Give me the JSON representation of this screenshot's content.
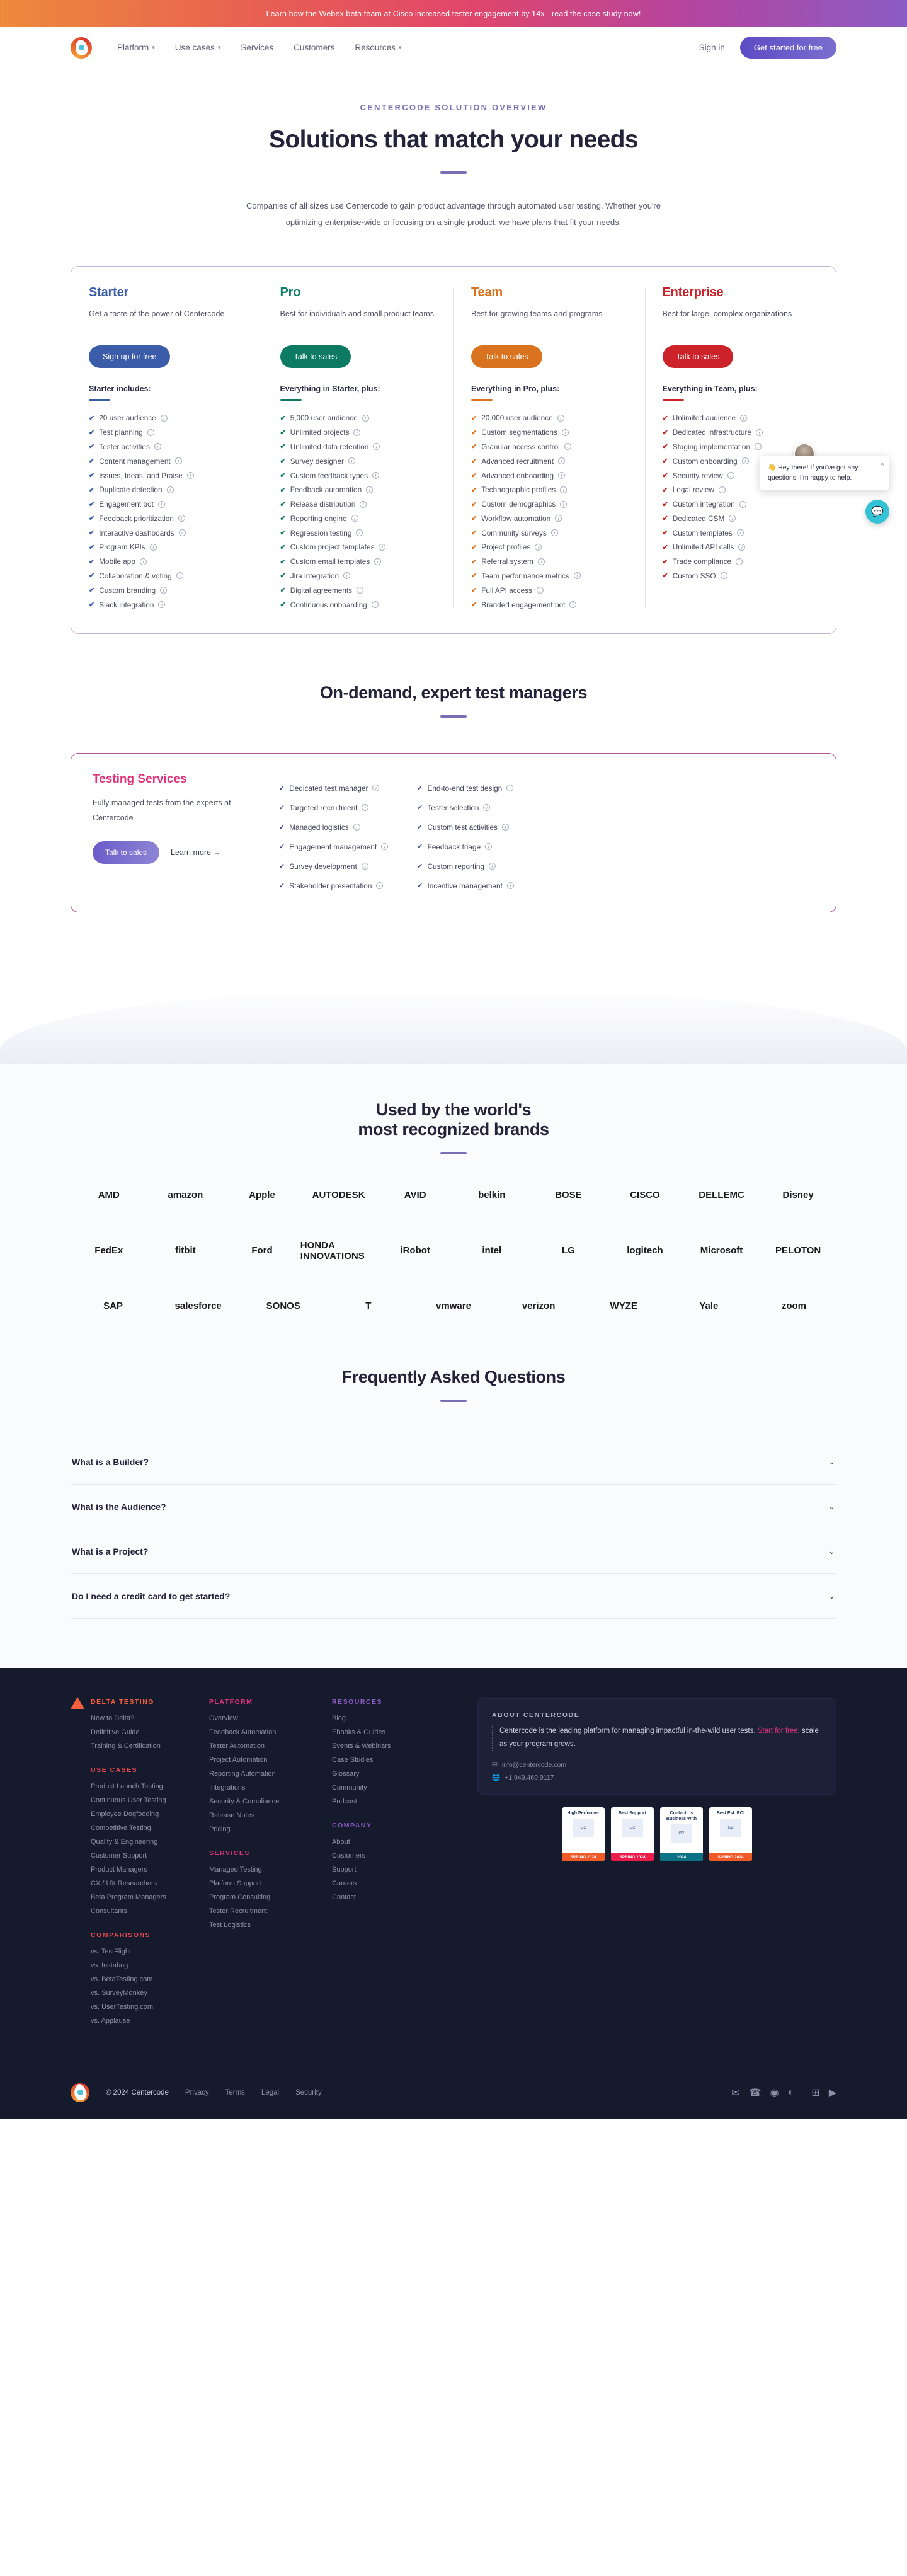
{
  "banner": {
    "text": "Learn how the Webex beta team at Cisco increased tester engagement by 14x - read the case study now!"
  },
  "nav": {
    "links": [
      {
        "label": "Platform",
        "has_caret": true
      },
      {
        "label": "Use cases",
        "has_caret": true
      },
      {
        "label": "Services",
        "has_caret": false
      },
      {
        "label": "Customers",
        "has_caret": false
      },
      {
        "label": "Resources",
        "has_caret": true
      }
    ],
    "signin": "Sign in",
    "cta": "Get started for free"
  },
  "hero": {
    "eyebrow": "CENTERCODE SOLUTION OVERVIEW",
    "title": "Solutions that match your needs",
    "body": "Companies of all sizes use Centercode to gain product advantage through automated user testing. Whether you're optimizing enterprise-wide or focusing on a single product, we have plans that fit your needs."
  },
  "plans": [
    {
      "name": "Starter",
      "color": "#3b5ca8",
      "desc": "Get a taste of the power of Centercode",
      "cta": "Sign up for free",
      "includes": "Starter includes:",
      "features": [
        "20 user audience",
        "Test planning",
        "Tester activities",
        "Content management",
        "Issues, Ideas, and Praise",
        "Duplicate detection",
        "Engagement bot",
        "Feedback prioritization",
        "Interactive dashboards",
        "Program KPIs",
        "Mobile app",
        "Collaboration & voting",
        "Custom branding",
        "Slack integration"
      ]
    },
    {
      "name": "Pro",
      "color": "#0d7a63",
      "desc": "Best for individuals and small product teams",
      "cta": "Talk to sales",
      "includes": "Everything in Starter, plus:",
      "features": [
        "5,000 user audience",
        "Unlimited projects",
        "Unlimited data retention",
        "Survey designer",
        "Custom feedback types",
        "Feedback automation",
        "Release distribution",
        "Reporting engine",
        "Regression testing",
        "Custom project templates",
        "Custom email templates",
        "Jira integration",
        "Digital agreements",
        "Continuous onboarding"
      ]
    },
    {
      "name": "Team",
      "color": "#d9731f",
      "desc": "Best for growing teams and programs",
      "cta": "Talk to sales",
      "includes": "Everything in Pro, plus:",
      "features": [
        "20,000 user audience",
        "Custom segmentations",
        "Granular access control",
        "Advanced recruitment",
        "Advanced onboarding",
        "Technographic profiles",
        "Custom demographics",
        "Workflow automation",
        "Community surveys",
        "Project profiles",
        "Referral system",
        "Team performance metrics",
        "Full API access",
        "Branded engagement bot"
      ]
    },
    {
      "name": "Enterprise",
      "color": "#cc2229",
      "desc": "Best for large, complex organizations",
      "cta": "Talk to sales",
      "includes": "Everything in Team, plus:",
      "features": [
        "Unlimited audience",
        "Dedicated infrastructure",
        "Staging implementation",
        "Custom onboarding",
        "Security review",
        "Legal review",
        "Custom integration",
        "Dedicated CSM",
        "Custom templates",
        "Unlimited API calls",
        "Trade compliance",
        "Custom SSO"
      ]
    }
  ],
  "chat": {
    "message": "👋 Hey there! If you've got any questions, I'm happy to help.",
    "close": "×"
  },
  "services": {
    "heading": "On-demand, expert test managers",
    "card_title": "Testing Services",
    "card_desc": "Fully managed tests from the experts at Centercode",
    "cta": "Talk to sales",
    "learn_more": "Learn more →",
    "col1": [
      "Dedicated test manager",
      "Targeted recruitment",
      "Managed logistics",
      "Engagement management",
      "Survey development",
      "Stakeholder presentation"
    ],
    "col2": [
      "End-to-end test design",
      "Tester selection",
      "Custom test activities",
      "Feedback triage",
      "Custom reporting",
      "Incentive management"
    ]
  },
  "brands": {
    "heading_line1": "Used by the world's",
    "heading_line2": "most recognized brands",
    "rows": [
      [
        "AMD",
        "amazon",
        "Apple",
        "AUTODESK",
        "AVID",
        "belkin",
        "BOSE",
        "CISCO",
        "DELLEMC",
        "Disney"
      ],
      [
        "FedEx",
        "fitbit",
        "Ford",
        "HONDA INNOVATIONS",
        "iRobot",
        "intel",
        "LG",
        "logitech",
        "Microsoft",
        "PELOTON"
      ],
      [
        "SAP",
        "salesforce",
        "SONOS",
        "T",
        "vmware",
        "verizon",
        "WYZE",
        "Yale",
        "zoom"
      ]
    ]
  },
  "faq": {
    "heading": "Frequently Asked Questions",
    "items": [
      {
        "q": "What is a Builder?",
        "chevron": "⌄"
      },
      {
        "q": "What is the Audience?",
        "chevron": "⌄"
      },
      {
        "q": "What is a Project?",
        "chevron": "⌄"
      },
      {
        "q": "Do I need a credit card to get started?",
        "chevron": "⌄"
      }
    ]
  },
  "footer": {
    "col1": [
      {
        "head": "DELTA TESTING",
        "head_color": "orange",
        "links": [
          "New to Delta?",
          "Definitive Guide",
          "Training & Certification"
        ]
      },
      {
        "head": "USE CASES",
        "head_color": "red",
        "links": [
          "Product Launch Testing",
          "Continuous User Testing",
          "Employee Dogfooding",
          "Competitive Testing",
          "Quality & Engineering",
          "Customer Support",
          "Product Managers",
          "CX / UX Researchers",
          "Beta Program Managers",
          "Consultants"
        ]
      },
      {
        "head": "COMPARISONS",
        "head_color": "red",
        "links": [
          "vs. TestFlight",
          "vs. Instabug",
          "vs. BetaTesting.com",
          "vs. SurveyMonkey",
          "vs. UserTesting.com",
          "vs. Applause"
        ]
      }
    ],
    "col2": [
      {
        "head": "PLATFORM",
        "head_color": "pink",
        "links": [
          "Overview",
          "Feedback Automation",
          "Tester Automation",
          "Project Automation",
          "Reporting Automation",
          "Integrations",
          "Security & Compliance",
          "Release Notes",
          "Pricing"
        ]
      },
      {
        "head": "SERVICES",
        "head_color": "pink",
        "links": [
          "Managed Testing",
          "Platform Support",
          "Program Consulting",
          "Tester Recruitment",
          "Test Logistics"
        ]
      }
    ],
    "col3": [
      {
        "head": "RESOURCES",
        "head_color": "purple",
        "links": [
          "Blog",
          "Ebooks & Guides",
          "Events & Webinars",
          "Case Studies",
          "Glossary",
          "Community",
          "Podcast"
        ]
      },
      {
        "head": "COMPANY",
        "head_color": "purple",
        "links": [
          "About",
          "Customers",
          "Support",
          "Careers",
          "Contact"
        ]
      }
    ],
    "about": {
      "head": "ABOUT CENTERCODE",
      "body_pre": "Centercode is the leading platform for managing impactful in-the-wild user tests. ",
      "link": "Start for free",
      "body_post": ", scale as your program grows.",
      "email": "info@centercode.com",
      "phone": "+1.949.460.9117"
    },
    "badges": [
      {
        "top": "High Performer",
        "mid": "G2",
        "bar": "SPRING 2024",
        "bar_color": "#f05a28"
      },
      {
        "top": "Best Support",
        "mid": "G2",
        "bar": "SPRING 2024",
        "bar_color": "#ec1c4b"
      },
      {
        "top": "Contact Us Business With",
        "mid": "G2",
        "bar": "2024",
        "bar_color": "#0b7285"
      },
      {
        "top": "Best Est. ROI",
        "mid": "G2",
        "bar": "SPRING 2024",
        "bar_color": "#f05a28"
      }
    ],
    "copyright": "© 2024 Centercode",
    "bottom_links": [
      "Privacy",
      "Terms",
      "Legal",
      "Security"
    ],
    "socials": [
      "email-icon",
      "phone-icon",
      "discord-icon",
      "spotify-icon",
      "twitter-icon",
      "linkedin-icon",
      "youtube-icon"
    ]
  }
}
